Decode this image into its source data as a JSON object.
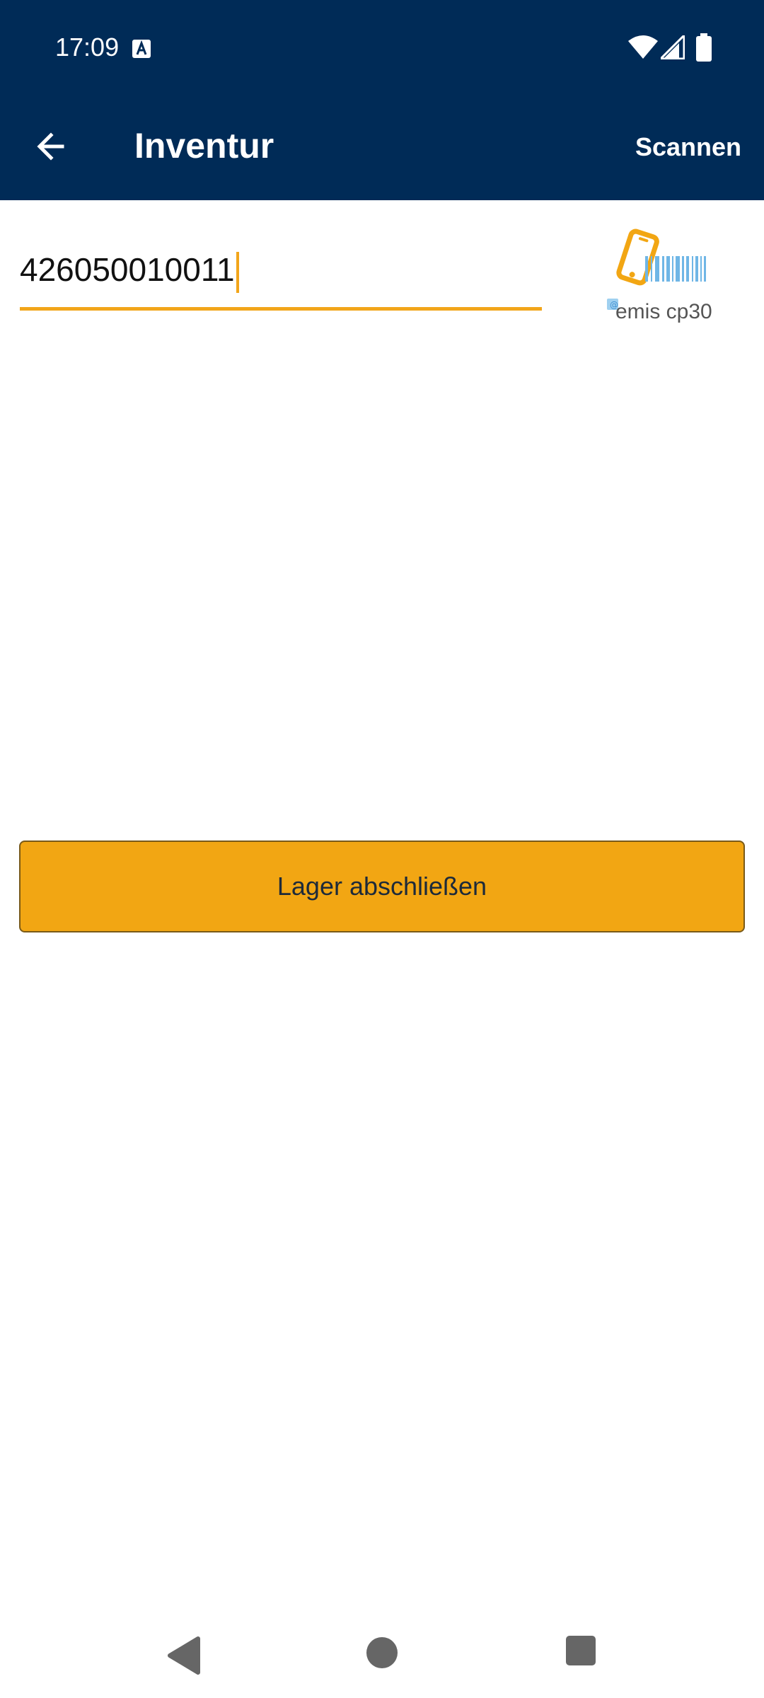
{
  "status_bar": {
    "time": "17:09",
    "icons": [
      "a-notification-icon",
      "wifi-icon",
      "signal-icon",
      "battery-icon"
    ]
  },
  "app_bar": {
    "title": "Inventur",
    "back_icon": "arrow-left-icon",
    "action_label": "Scannen"
  },
  "barcode_field": {
    "value": "426050010011"
  },
  "brand": {
    "logo_icon": "phone-barcode-icon",
    "name": "emis cp30"
  },
  "main": {
    "lager_button_label": "Lager abschließen"
  },
  "nav_bar": {
    "icons": [
      "back-triangle-icon",
      "home-circle-icon",
      "recents-square-icon"
    ]
  },
  "colors": {
    "primary": "#002b57",
    "accent": "#f2a613",
    "text": "#111111"
  }
}
